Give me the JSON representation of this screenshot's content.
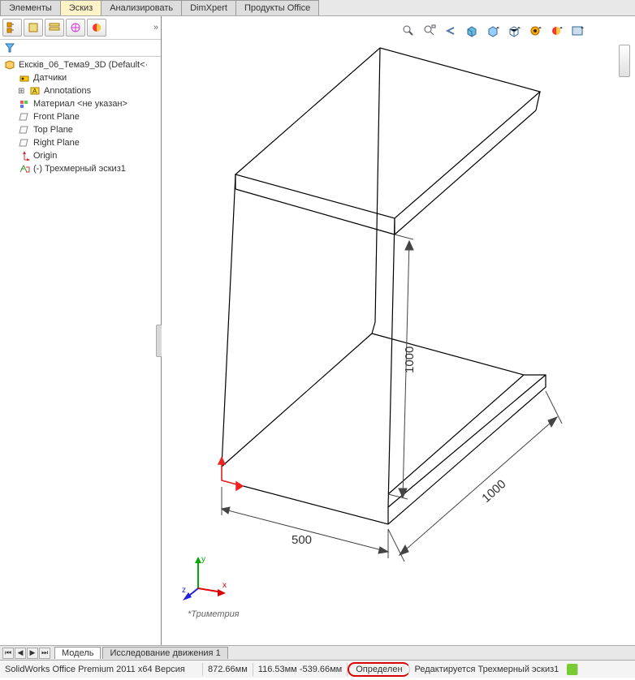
{
  "tabs": {
    "elements": "Элементы",
    "sketch": "Эскиз",
    "analyze": "Анализировать",
    "dimxpert": "DimXpert",
    "office": "Продукты Office"
  },
  "sidebar_icons": [
    "design-tree",
    "config",
    "properties",
    "appearance",
    "display",
    "more"
  ],
  "tree": {
    "root": "Ексків_06_Тема9_3D  (Default<·",
    "sensors": "Датчики",
    "annotations": "Annotations",
    "material": "Материал <не указан>",
    "front": "Front Plane",
    "top": "Top Plane",
    "right": "Right Plane",
    "origin": "Origin",
    "sketch3d": "(-) Трехмерный эскиз1"
  },
  "dimensions": {
    "width": "500",
    "height": "1000",
    "depth": "1000"
  },
  "triad": {
    "x": "x",
    "y": "y",
    "z": "z"
  },
  "view_label": "*Триметрия",
  "bottom_tabs": {
    "model": "Модель",
    "motion": "Исследование движения 1"
  },
  "status": {
    "product": "SolidWorks Office Premium 2011 x64 Версия",
    "len": "872.66мм",
    "coords": "116.53мм -539.66мм",
    "defined": "Определен",
    "editing": "Редактируется Трехмерный эскиз1"
  }
}
